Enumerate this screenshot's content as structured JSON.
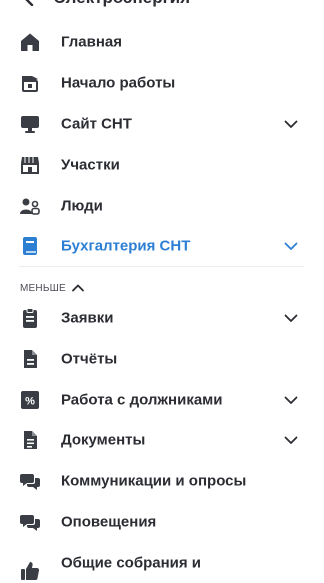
{
  "header": {
    "title": "Электроэнергия"
  },
  "menu": {
    "items": [
      {
        "label": "Главная",
        "icon": "home-icon"
      },
      {
        "label": "Начало работы",
        "icon": "graduation-cap-icon"
      },
      {
        "label": "Сайт СНТ",
        "icon": "monitor-icon",
        "expandable": true
      },
      {
        "label": "Участки",
        "icon": "store-icon"
      },
      {
        "label": "Люди",
        "icon": "people-icon"
      },
      {
        "label": "Бухгалтерия СНТ",
        "icon": "book-icon",
        "expandable": true,
        "active": true
      },
      {
        "label": "Заявки",
        "icon": "clipboard-icon",
        "expandable": true
      },
      {
        "label": "Отчёты",
        "icon": "document-icon"
      },
      {
        "label": "Работа с должниками",
        "icon": "percent-icon",
        "expandable": true
      },
      {
        "label": "Документы",
        "icon": "file-icon",
        "expandable": true
      },
      {
        "label": "Коммуникации и опросы",
        "icon": "chat-icon"
      },
      {
        "label": "Оповещения",
        "icon": "chat-bubbles-icon"
      },
      {
        "label": "Общие собрания и",
        "icon": "thumb-up-icon"
      }
    ],
    "less_label": "МЕНЬШЕ"
  },
  "colors": {
    "text": "#2b2d33",
    "accent": "#2d7fd3",
    "divider": "#ececf0"
  }
}
